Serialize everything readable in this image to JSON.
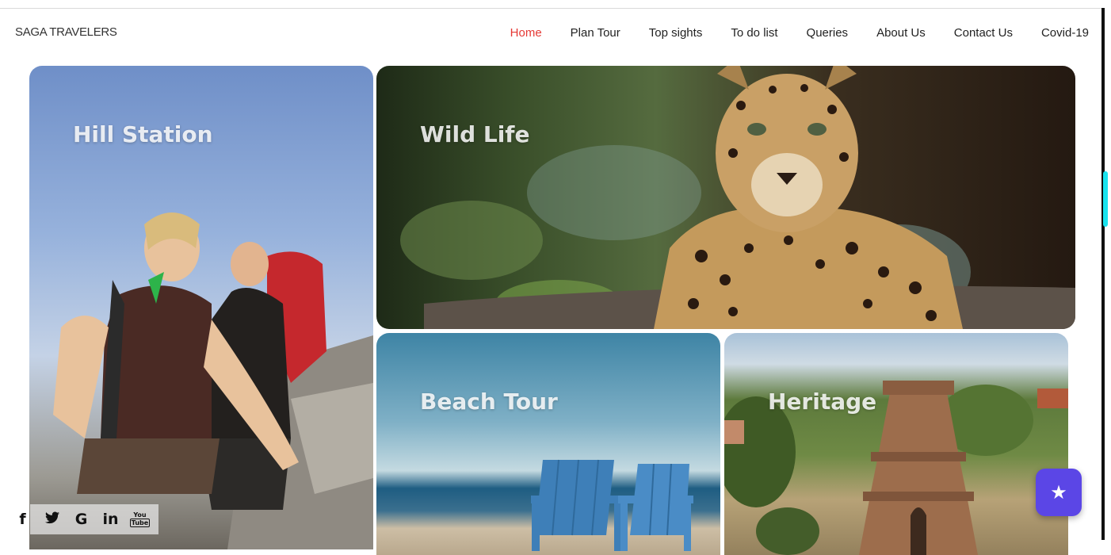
{
  "brand": "SAGA TRAVELERS",
  "nav": {
    "items": [
      {
        "label": "Home",
        "active": true
      },
      {
        "label": "Plan Tour",
        "active": false
      },
      {
        "label": "Top sights",
        "active": false
      },
      {
        "label": "To do list",
        "active": false
      },
      {
        "label": "Queries",
        "active": false
      },
      {
        "label": "About Us",
        "active": false
      },
      {
        "label": "Contact Us",
        "active": false
      },
      {
        "label": "Covid-19",
        "active": false
      }
    ]
  },
  "tiles": {
    "hill_station": "Hill Station",
    "wild_life": "Wild Life",
    "beach_tour": "Beach Tour",
    "heritage": "Heritage"
  },
  "social": {
    "facebook": "f",
    "twitter": "🐦",
    "google": "G",
    "linkedin": "in",
    "youtube_top": "You",
    "youtube_bottom": "Tube"
  },
  "fab": {
    "icon": "star-icon",
    "glyph": "★"
  },
  "colors": {
    "accent_active": "#e53935",
    "fab": "#5b46e6",
    "scroll_thumb": "#19e3ee"
  }
}
